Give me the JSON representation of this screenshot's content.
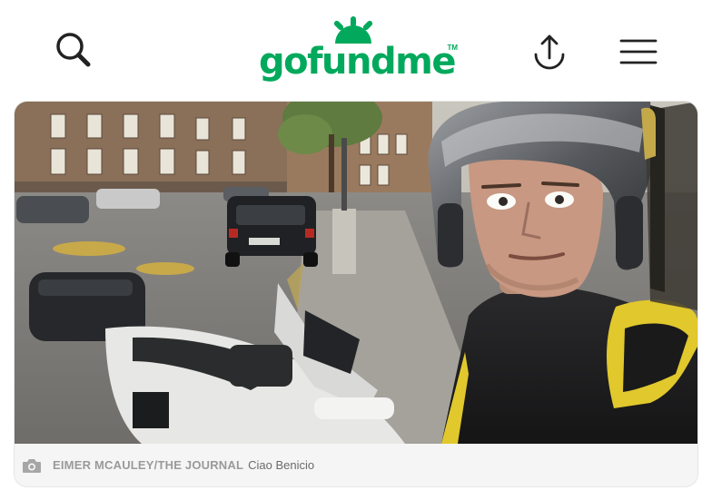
{
  "header": {
    "logo_text": "gofundme",
    "logo_tm": "TM",
    "brand_color": "#02a95c",
    "search_icon": "search-icon",
    "share_icon": "share-icon",
    "menu_icon": "hamburger-menu-icon"
  },
  "photo": {
    "description_icon": "selfie-motorbike-photo",
    "caption_icon": "camera-icon",
    "credit": "EIMER MCAULEY/THE JOURNAL",
    "caption": "Ciao Benicio"
  }
}
